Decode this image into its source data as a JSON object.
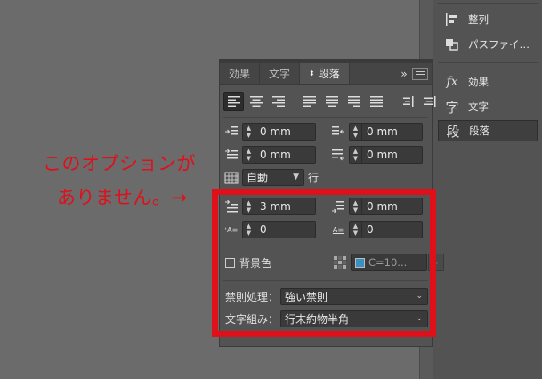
{
  "dock": {
    "items": [
      {
        "label": "整列",
        "icon": "align-icon"
      },
      {
        "label": "パスファイ…",
        "icon": "pathfinder-icon"
      },
      {
        "label": "効果",
        "icon": "fx-icon"
      },
      {
        "label": "文字",
        "icon": "character-icon"
      },
      {
        "label": "段落",
        "icon": "paragraph-icon"
      }
    ]
  },
  "panel": {
    "tabs": [
      "効果",
      "文字",
      "段落"
    ],
    "active_tab": "段落",
    "collapse_label": "»",
    "left_indent": "0 mm",
    "right_indent": "0 mm",
    "first_line_indent": "0 mm",
    "last_line_indent": "0 mm",
    "leading_mode": "自動",
    "leading_unit": "行",
    "space_before": "3 mm",
    "space_after": "0 mm",
    "drop_cap_lines": "0",
    "drop_cap_chars": "0",
    "background_color_label": "背景色",
    "swatch_value": "C=10...",
    "swatch_color": "#3a8fc5",
    "kinsoku_label": "禁則処理：",
    "kinsoku_value": "強い禁則",
    "mojikumi_label": "文字組み：",
    "mojikumi_value": "行末約物半角"
  },
  "annotation": {
    "line1": "このオプションが",
    "line2": "ありません。→",
    "color": "#e0101b"
  }
}
